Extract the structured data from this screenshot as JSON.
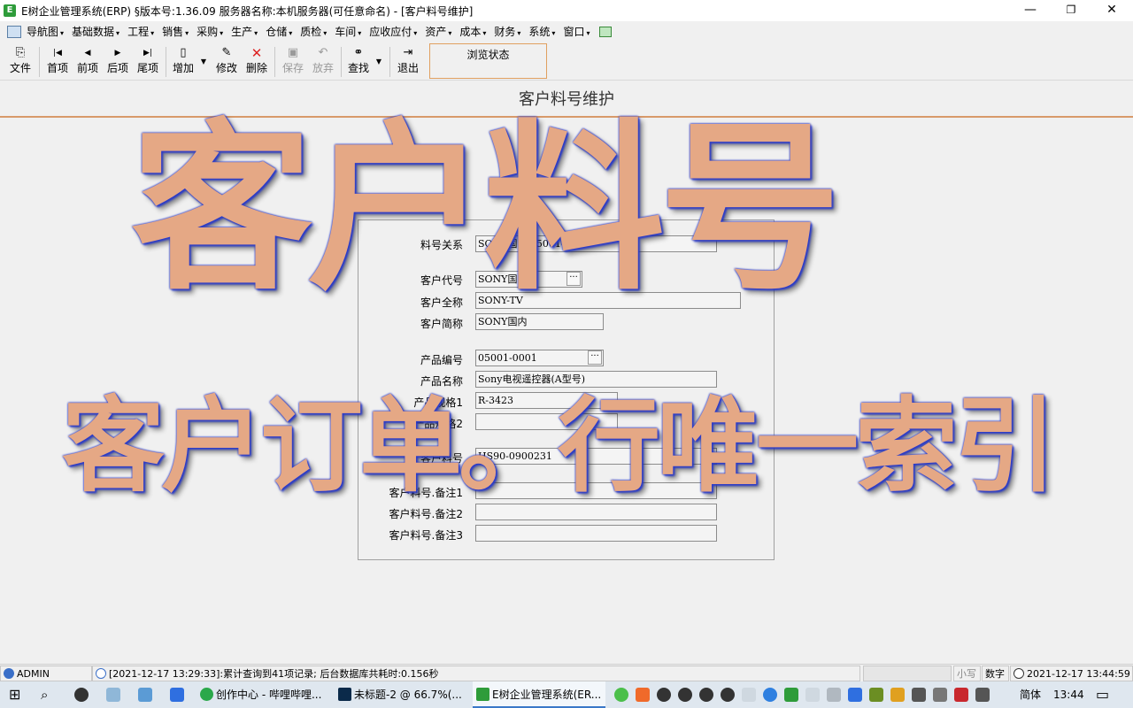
{
  "window": {
    "title": "E树企业管理系统(ERP) §版本号:1.36.09  服务器名称:本机服务器(可任意命名) - [客户料号维护]",
    "min": "—",
    "max": "❐",
    "close": "✕"
  },
  "menu": [
    "导航图",
    "基础数据",
    "工程",
    "销售",
    "采购",
    "生产",
    "仓储",
    "质检",
    "车间",
    "应收应付",
    "资产",
    "成本",
    "财务",
    "系统",
    "窗口"
  ],
  "toolbar": {
    "file": "文件",
    "first": "首项",
    "prev": "前项",
    "next": "后项",
    "last": "尾项",
    "add": "增加",
    "edit": "修改",
    "delete": "删除",
    "save": "保存",
    "discard": "放弃",
    "find": "查找",
    "exit": "退出",
    "status": "浏览状态"
  },
  "page_title": "客户料号维护",
  "watermark": {
    "line1": "客户料号",
    "line2": "客户订单。行唯一索引"
  },
  "form": {
    "relation_label": "料号关系",
    "relation_value": "SONY国内 05001-0001",
    "cust_code_label": "客户代号",
    "cust_code_value": "SONY国内",
    "cust_full_label": "客户全称",
    "cust_full_value": "SONY-TV",
    "cust_short_label": "客户简称",
    "cust_short_value": "SONY国内",
    "prod_code_label": "产品编号",
    "prod_code_value": "05001-0001",
    "prod_name_label": "产品名称",
    "prod_name_value": "Sony电视遥控器(A型号)",
    "spec1_label": "产品规格1",
    "spec1_value": "R-3423",
    "spec2_label": "产品规格2",
    "spec2_value": "",
    "cust_part_label": "客户料号",
    "cust_part_value": "HS90-0900231",
    "note1_label": "客户料号.备注1",
    "note1_value": "",
    "note2_label": "客户料号.备注2",
    "note2_value": "",
    "note3_label": "客户料号.备注3",
    "note3_value": ""
  },
  "statusbar": {
    "user": "ADMIN",
    "message": "[2021-12-17 13:29:33]:累计查询到41项记录; 后台数据库共耗时:0.156秒",
    "lower": "小写",
    "num": "数字",
    "datetime": "2021-12-17  13:44:59"
  },
  "taskbar": {
    "app1": "创作中心 - 哔哩哔哩...",
    "app2": "未标题-2 @ 66.7%(...",
    "app3": "E树企业管理系统(ER...",
    "ime": "简体",
    "time": "13:44"
  }
}
